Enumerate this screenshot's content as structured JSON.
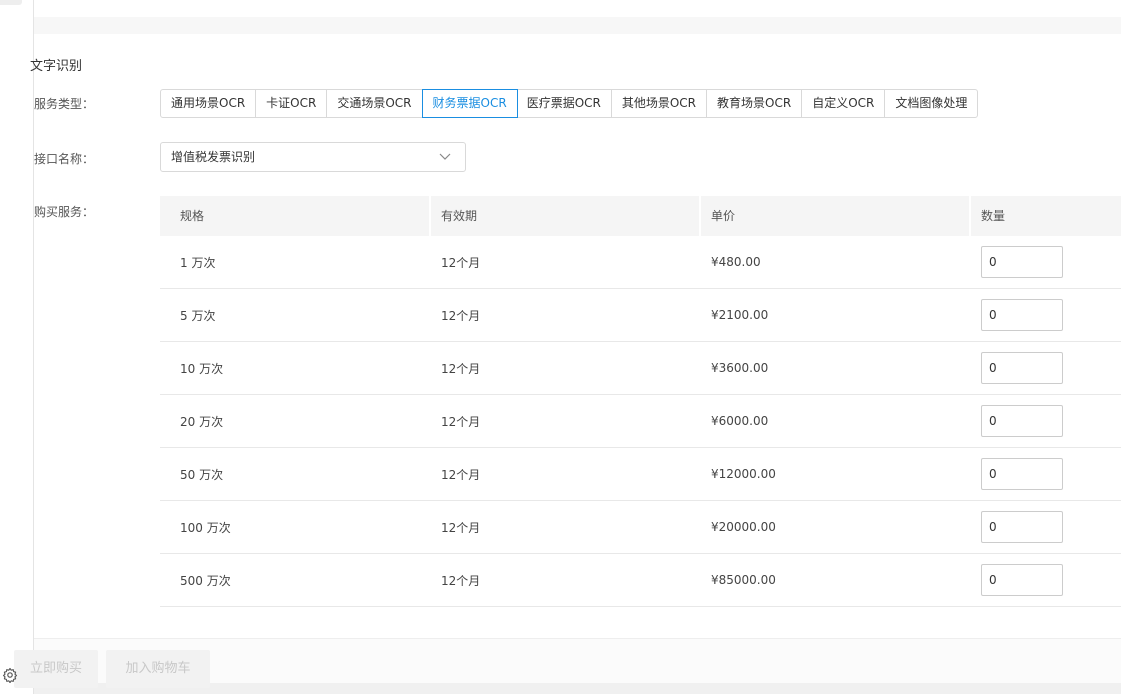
{
  "section_title": "文字识别",
  "labels": {
    "service_type": "服务类型：",
    "api_name": "接口名称：",
    "purchase": "购买服务："
  },
  "service_tabs": [
    {
      "label": "通用场景OCR",
      "active": false
    },
    {
      "label": "卡证OCR",
      "active": false
    },
    {
      "label": "交通场景OCR",
      "active": false
    },
    {
      "label": "财务票据OCR",
      "active": true
    },
    {
      "label": "医疗票据OCR",
      "active": false
    },
    {
      "label": "其他场景OCR",
      "active": false
    },
    {
      "label": "教育场景OCR",
      "active": false
    },
    {
      "label": "自定义OCR",
      "active": false
    },
    {
      "label": "文档图像处理",
      "active": false
    }
  ],
  "api_select": {
    "value": "增值税发票识别"
  },
  "table": {
    "headers": [
      "规格",
      "有效期",
      "单价",
      "数量"
    ],
    "rows": [
      {
        "spec": "1 万次",
        "validity": "12个月",
        "price": "¥480.00",
        "qty": "0"
      },
      {
        "spec": "5 万次",
        "validity": "12个月",
        "price": "¥2100.00",
        "qty": "0"
      },
      {
        "spec": "10 万次",
        "validity": "12个月",
        "price": "¥3600.00",
        "qty": "0"
      },
      {
        "spec": "20 万次",
        "validity": "12个月",
        "price": "¥6000.00",
        "qty": "0"
      },
      {
        "spec": "50 万次",
        "validity": "12个月",
        "price": "¥12000.00",
        "qty": "0"
      },
      {
        "spec": "100 万次",
        "validity": "12个月",
        "price": "¥20000.00",
        "qty": "0"
      },
      {
        "spec": "500 万次",
        "validity": "12个月",
        "price": "¥85000.00",
        "qty": "0"
      }
    ]
  },
  "buttons": {
    "buy": "立即购买",
    "cart": "加入购物车"
  },
  "icons": {
    "settings": "gear-icon",
    "dropdown": "chevron-down-icon"
  }
}
